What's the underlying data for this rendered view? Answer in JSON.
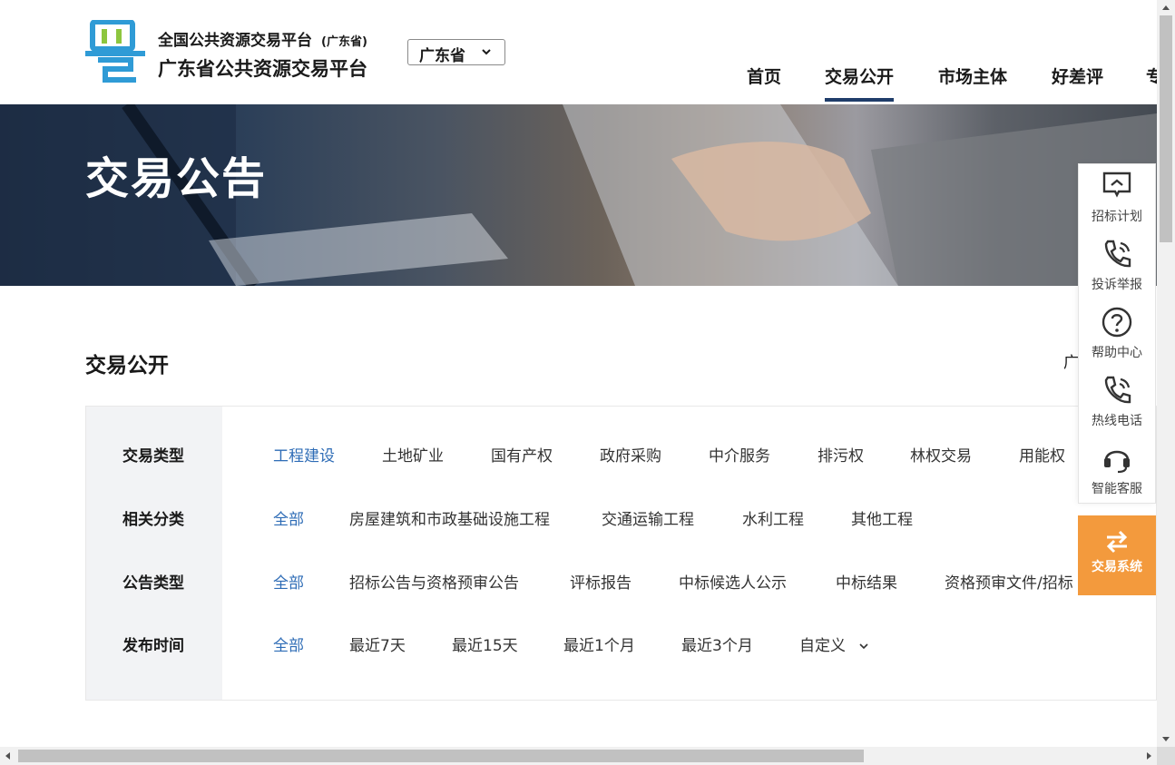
{
  "header": {
    "brand_top": "全国公共资源交易平台",
    "brand_top_sub": "(广东省)",
    "brand_main": "广东省公共资源交易平台",
    "region_select": "广东省",
    "nav": [
      "首页",
      "交易公开",
      "市场主体",
      "好差评",
      "专"
    ],
    "active_nav": "交易公开"
  },
  "banner": {
    "title": "交易公告"
  },
  "section": {
    "title": "交易公开",
    "right_text": "广"
  },
  "filters": {
    "trade_type": {
      "label": "交易类型",
      "options": [
        "工程建设",
        "土地矿业",
        "国有产权",
        "政府采购",
        "中介服务",
        "排污权",
        "林权交易",
        "用能权"
      ],
      "selected": "工程建设"
    },
    "category": {
      "label": "相关分类",
      "options": [
        "全部",
        "房屋建筑和市政基础设施工程",
        "交通运输工程",
        "水利工程",
        "其他工程"
      ],
      "selected": "全部"
    },
    "notice_type": {
      "label": "公告类型",
      "options": [
        "全部",
        "招标公告与资格预审公告",
        "评标报告",
        "中标候选人公示",
        "中标结果",
        "资格预审文件/招标"
      ],
      "selected": "全部"
    },
    "publish_time": {
      "label": "发布时间",
      "options": [
        "全部",
        "最近7天",
        "最近15天",
        "最近1个月",
        "最近3个月",
        "自定义"
      ],
      "selected": "全部"
    }
  },
  "side_toolbar": {
    "items": [
      "招标计划",
      "投诉举报",
      "帮助中心",
      "热线电话",
      "智能客服"
    ],
    "trade_system": "交易系统"
  },
  "colors": {
    "accent": "#2e6cb6",
    "nav_underline": "#1f3d6a",
    "side_button": "#f39a3d",
    "filter_label_bg": "#f2f3f5"
  }
}
